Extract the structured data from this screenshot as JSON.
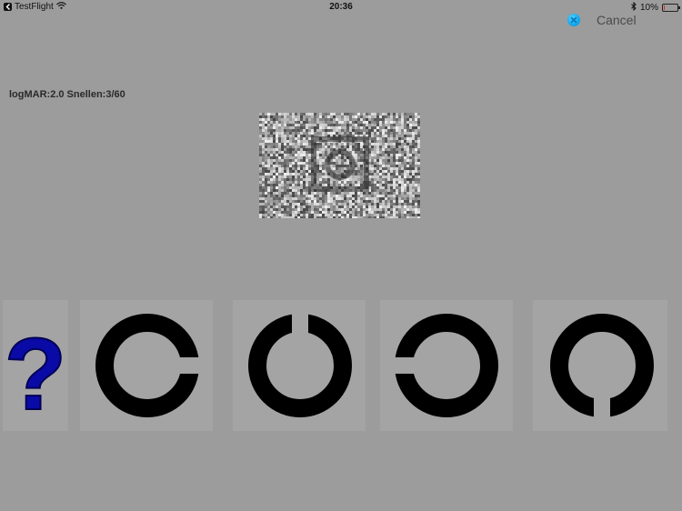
{
  "status_bar": {
    "back_app": "TestFlight",
    "time": "20:36",
    "battery_percent": "10%",
    "battery_level": 0.1,
    "icons": [
      "back-arrow-icon",
      "wifi-icon",
      "bluetooth-icon",
      "battery-icon"
    ]
  },
  "header": {
    "cancel_label": "Cancel",
    "cancel_icon": "clear-circle-icon",
    "accent_color": "#11a6ef"
  },
  "test": {
    "acuity_label": "logMAR:2.0 Snellen:3/60",
    "stimulus": "noise-masked Landolt C optotype"
  },
  "choices": [
    {
      "label": "?",
      "icon": "question-mark-icon",
      "color": "#0a0aa6"
    },
    {
      "label": "gap right",
      "icon": "landolt-c-right-icon"
    },
    {
      "label": "gap up",
      "icon": "landolt-c-up-icon"
    },
    {
      "label": "gap left",
      "icon": "landolt-c-left-icon"
    },
    {
      "label": "gap down",
      "icon": "landolt-c-down-icon"
    }
  ]
}
